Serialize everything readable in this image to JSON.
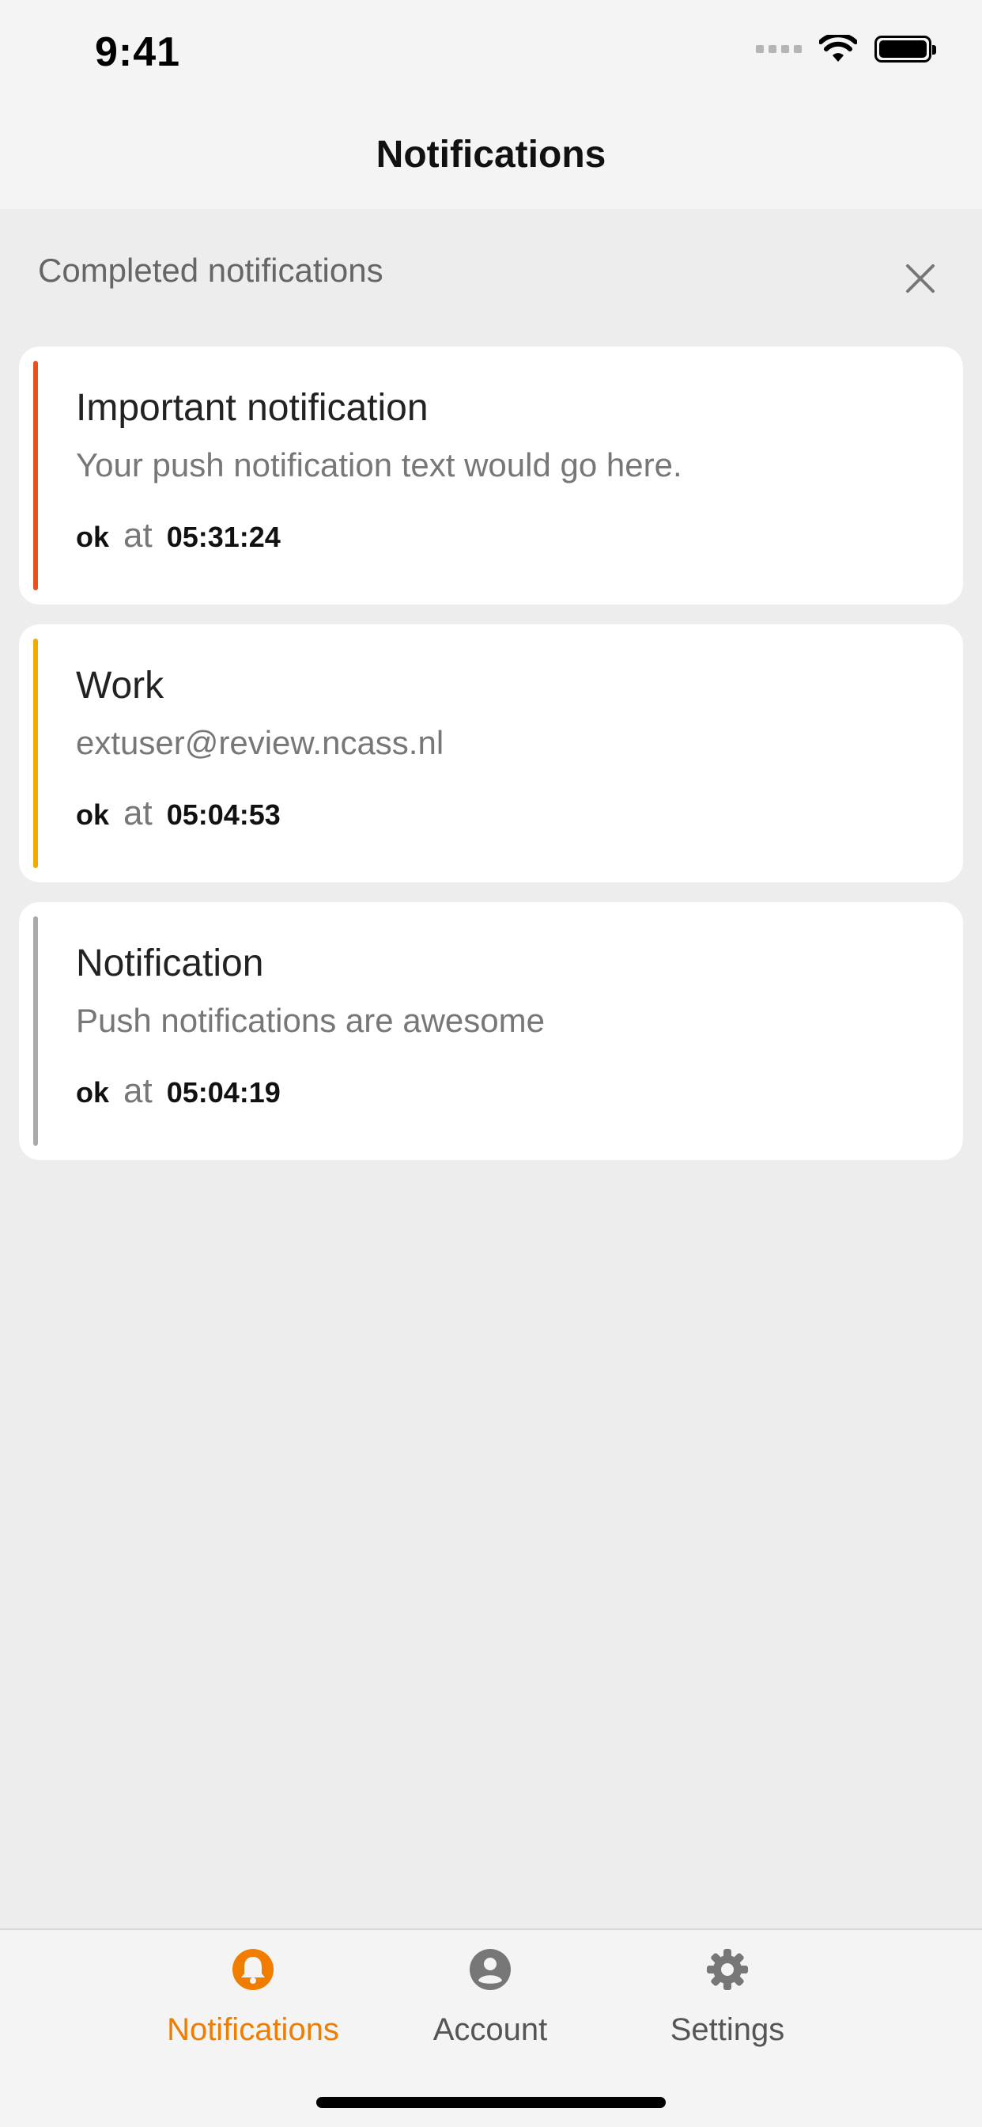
{
  "status_bar": {
    "time": "9:41"
  },
  "nav": {
    "title": "Notifications"
  },
  "section": {
    "label": "Completed notifications"
  },
  "notifications": [
    {
      "title": "Important notification",
      "body": "Your push notification text would go here.",
      "status": "ok",
      "at": "at",
      "time": "05:31:24",
      "color": "#e8501e"
    },
    {
      "title": "Work",
      "body": "extuser@review.ncass.nl",
      "status": "ok",
      "at": "at",
      "time": "05:04:53",
      "color": "#f2a900"
    },
    {
      "title": "Notification",
      "body": "Push notifications are awesome",
      "status": "ok",
      "at": "at",
      "time": "05:04:19",
      "color": "#aaaaaa"
    }
  ],
  "tabs": [
    {
      "label": "Notifications",
      "icon": "bell-icon",
      "active": true
    },
    {
      "label": "Account",
      "icon": "account-icon",
      "active": false
    },
    {
      "label": "Settings",
      "icon": "gear-icon",
      "active": false
    }
  ],
  "colors": {
    "accent": "#f07d00",
    "inactive": "#777777"
  }
}
